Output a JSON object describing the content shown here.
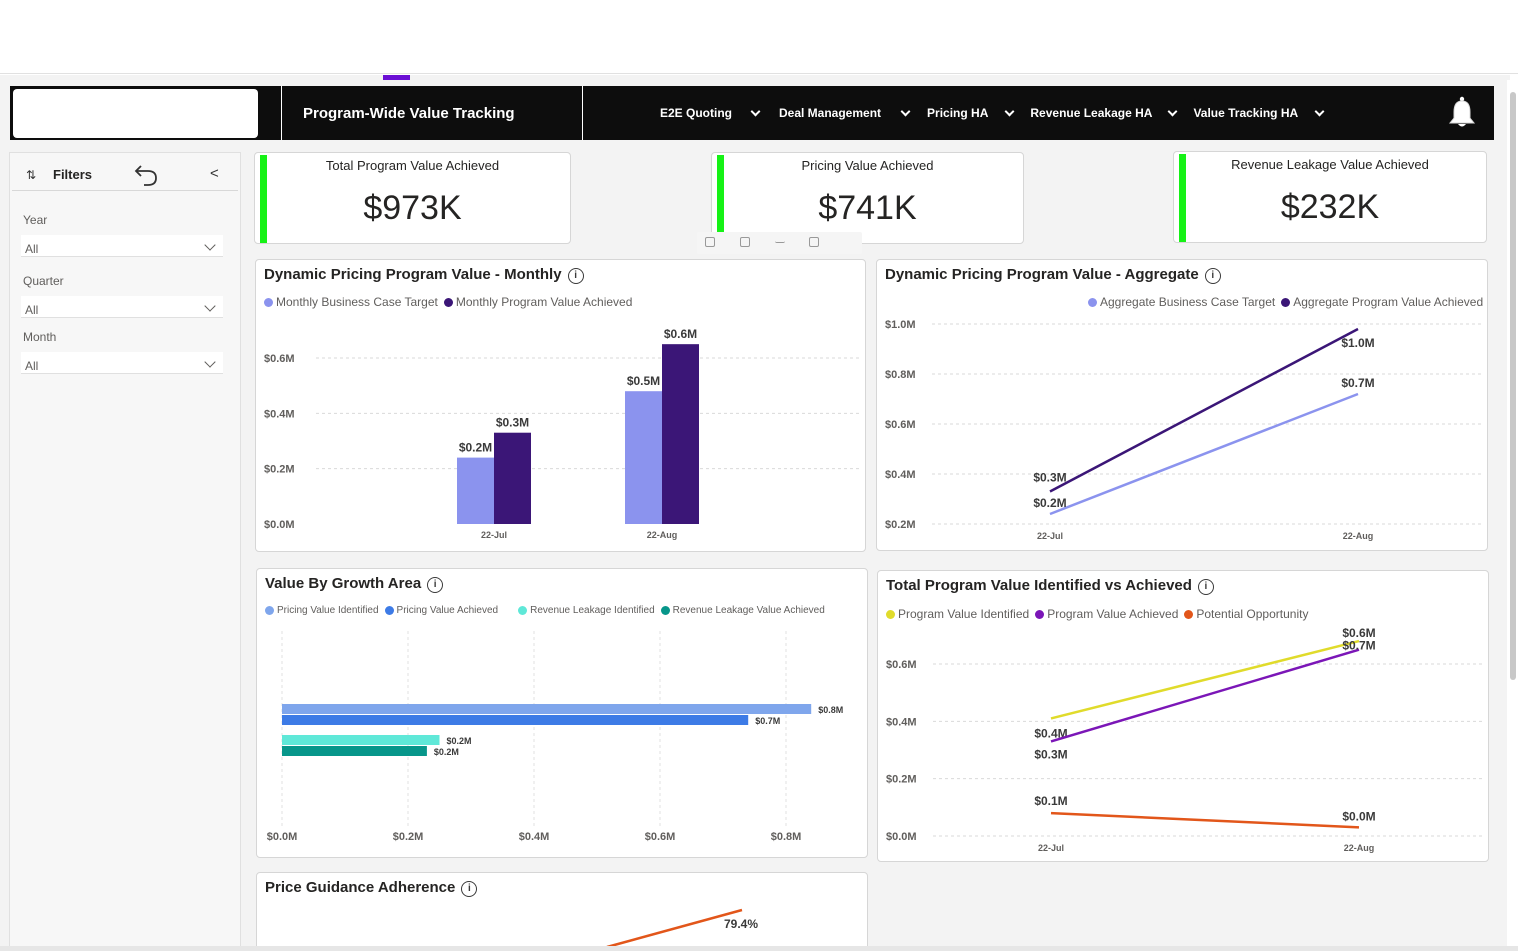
{
  "nav": {
    "title": "Program-Wide Value Tracking",
    "menu": [
      "E2E Quoting",
      "Deal Management",
      "Pricing HA",
      "Revenue Leakage HA",
      "Value Tracking HA"
    ],
    "icons": {
      "menu_chevron": "chevron-down-icon",
      "notifications": "bell-icon"
    }
  },
  "filters": {
    "title": "Filters",
    "collapse_glyph": "<",
    "year": {
      "label": "Year",
      "value": "All"
    },
    "quarter": {
      "label": "Quarter",
      "value": "All"
    },
    "month": {
      "label": "Month",
      "value": "All"
    }
  },
  "kpis": [
    {
      "title": "Total Program Value Achieved",
      "value": "$973K"
    },
    {
      "title": "Pricing Value Achieved",
      "value": "$741K"
    },
    {
      "title": "Revenue Leakage Value Achieved",
      "value": "$232K"
    }
  ],
  "colors": {
    "kpi_accent": "#16f216",
    "light_purple": "#8b93ee",
    "dark_purple": "#3b1677",
    "yellow": "#e0db2b",
    "violet": "#7b16b7",
    "orange": "#e2561a",
    "pricing_identified": "#7fa6ec",
    "pricing_achieved": "#3d7be6",
    "leakage_identified": "#5fe8d8",
    "leakage_achieved": "#07968a"
  },
  "charts": {
    "monthly": {
      "title": "Dynamic Pricing Program Value - Monthly",
      "info_glyph": "i",
      "legend": [
        "Monthly Business Case Target",
        "Monthly Program Value Achieved"
      ]
    },
    "aggregate": {
      "title": "Dynamic Pricing Program Value - Aggregate",
      "info_glyph": "i",
      "legend": [
        "Aggregate Business Case Target",
        "Aggregate Program Value Achieved"
      ]
    },
    "growth": {
      "title": "Value By Growth Area",
      "info_glyph": "i",
      "legend": [
        "Pricing Value Identified",
        "Pricing Value Achieved",
        "Revenue Leakage Identified",
        "Revenue Leakage Value Achieved"
      ]
    },
    "identified": {
      "title": "Total Program Value Identified vs Achieved",
      "info_glyph": "i",
      "legend": [
        "Program Value Identified",
        "Program Value Achieved",
        "Potential Opportunity"
      ]
    },
    "guidance": {
      "title": "Price Guidance Adherence",
      "info_glyph": "i"
    }
  },
  "chart_data": [
    {
      "id": "monthly",
      "type": "bar",
      "title": "Dynamic Pricing Program Value - Monthly",
      "categories": [
        "22-Jul",
        "22-Aug"
      ],
      "series": [
        {
          "name": "Monthly Business Case Target",
          "values": [
            0.24,
            0.48
          ],
          "labels": [
            "$0.2M",
            "$0.5M"
          ],
          "color": "#8b93ee"
        },
        {
          "name": "Monthly Program Value Achieved",
          "values": [
            0.33,
            0.65
          ],
          "labels": [
            "$0.3M",
            "$0.6M"
          ],
          "color": "#3b1677"
        }
      ],
      "yticks": [
        "$0.0M",
        "$0.2M",
        "$0.4M",
        "$0.6M"
      ],
      "ylim": [
        0,
        0.6
      ],
      "grid": true
    },
    {
      "id": "aggregate",
      "type": "line",
      "title": "Dynamic Pricing Program Value - Aggregate",
      "categories": [
        "22-Jul",
        "22-Aug"
      ],
      "series": [
        {
          "name": "Aggregate Business Case Target",
          "values": [
            0.24,
            0.72
          ],
          "labels": [
            "$0.2M",
            "$0.7M"
          ],
          "color": "#8b93ee"
        },
        {
          "name": "Aggregate Program Value Achieved",
          "values": [
            0.33,
            0.98
          ],
          "labels": [
            "$0.3M",
            "$1.0M"
          ],
          "color": "#3b1677"
        }
      ],
      "yticks": [
        "$0.2M",
        "$0.4M",
        "$0.6M",
        "$0.8M",
        "$1.0M"
      ],
      "ylim": [
        0.2,
        1.0
      ],
      "grid": true
    },
    {
      "id": "growth",
      "type": "bar",
      "orientation": "horizontal",
      "title": "Value By Growth Area",
      "series": [
        {
          "name": "Pricing Value Identified",
          "value": 0.84,
          "label": "$0.8M",
          "color": "#7fa6ec"
        },
        {
          "name": "Pricing Value Achieved",
          "value": 0.74,
          "label": "$0.7M",
          "color": "#3d7be6"
        },
        {
          "name": "Revenue Leakage Identified",
          "value": 0.25,
          "label": "$0.2M",
          "color": "#5fe8d8"
        },
        {
          "name": "Revenue Leakage Value Achieved",
          "value": 0.23,
          "label": "$0.2M",
          "color": "#07968a"
        }
      ],
      "xticks": [
        "$0.0M",
        "$0.2M",
        "$0.4M",
        "$0.6M",
        "$0.8M"
      ],
      "xlim": [
        0,
        0.8
      ],
      "grid": true
    },
    {
      "id": "identified",
      "type": "line",
      "title": "Total Program Value Identified vs Achieved",
      "categories": [
        "22-Jul",
        "22-Aug"
      ],
      "series": [
        {
          "name": "Program Value Identified",
          "values": [
            0.41,
            0.68
          ],
          "labels": [
            "$0.4M",
            "$0.6M"
          ],
          "color": "#e0db2b"
        },
        {
          "name": "Program Value Achieved",
          "values": [
            0.33,
            0.65
          ],
          "labels": [
            "$0.3M",
            "$0.7M"
          ],
          "color": "#7b16b7"
        },
        {
          "name": "Potential Opportunity",
          "values": [
            0.08,
            0.03
          ],
          "labels": [
            "$0.1M",
            "$0.0M"
          ],
          "color": "#e2561a"
        }
      ],
      "yticks": [
        "$0.0M",
        "$0.2M",
        "$0.4M",
        "$0.6M"
      ],
      "ylim": [
        0,
        0.6
      ],
      "grid": true
    },
    {
      "id": "guidance",
      "type": "line",
      "title": "Price Guidance Adherence",
      "series": [
        {
          "name": "",
          "end_label": "79.4%",
          "color": "#e2561a"
        }
      ]
    }
  ]
}
